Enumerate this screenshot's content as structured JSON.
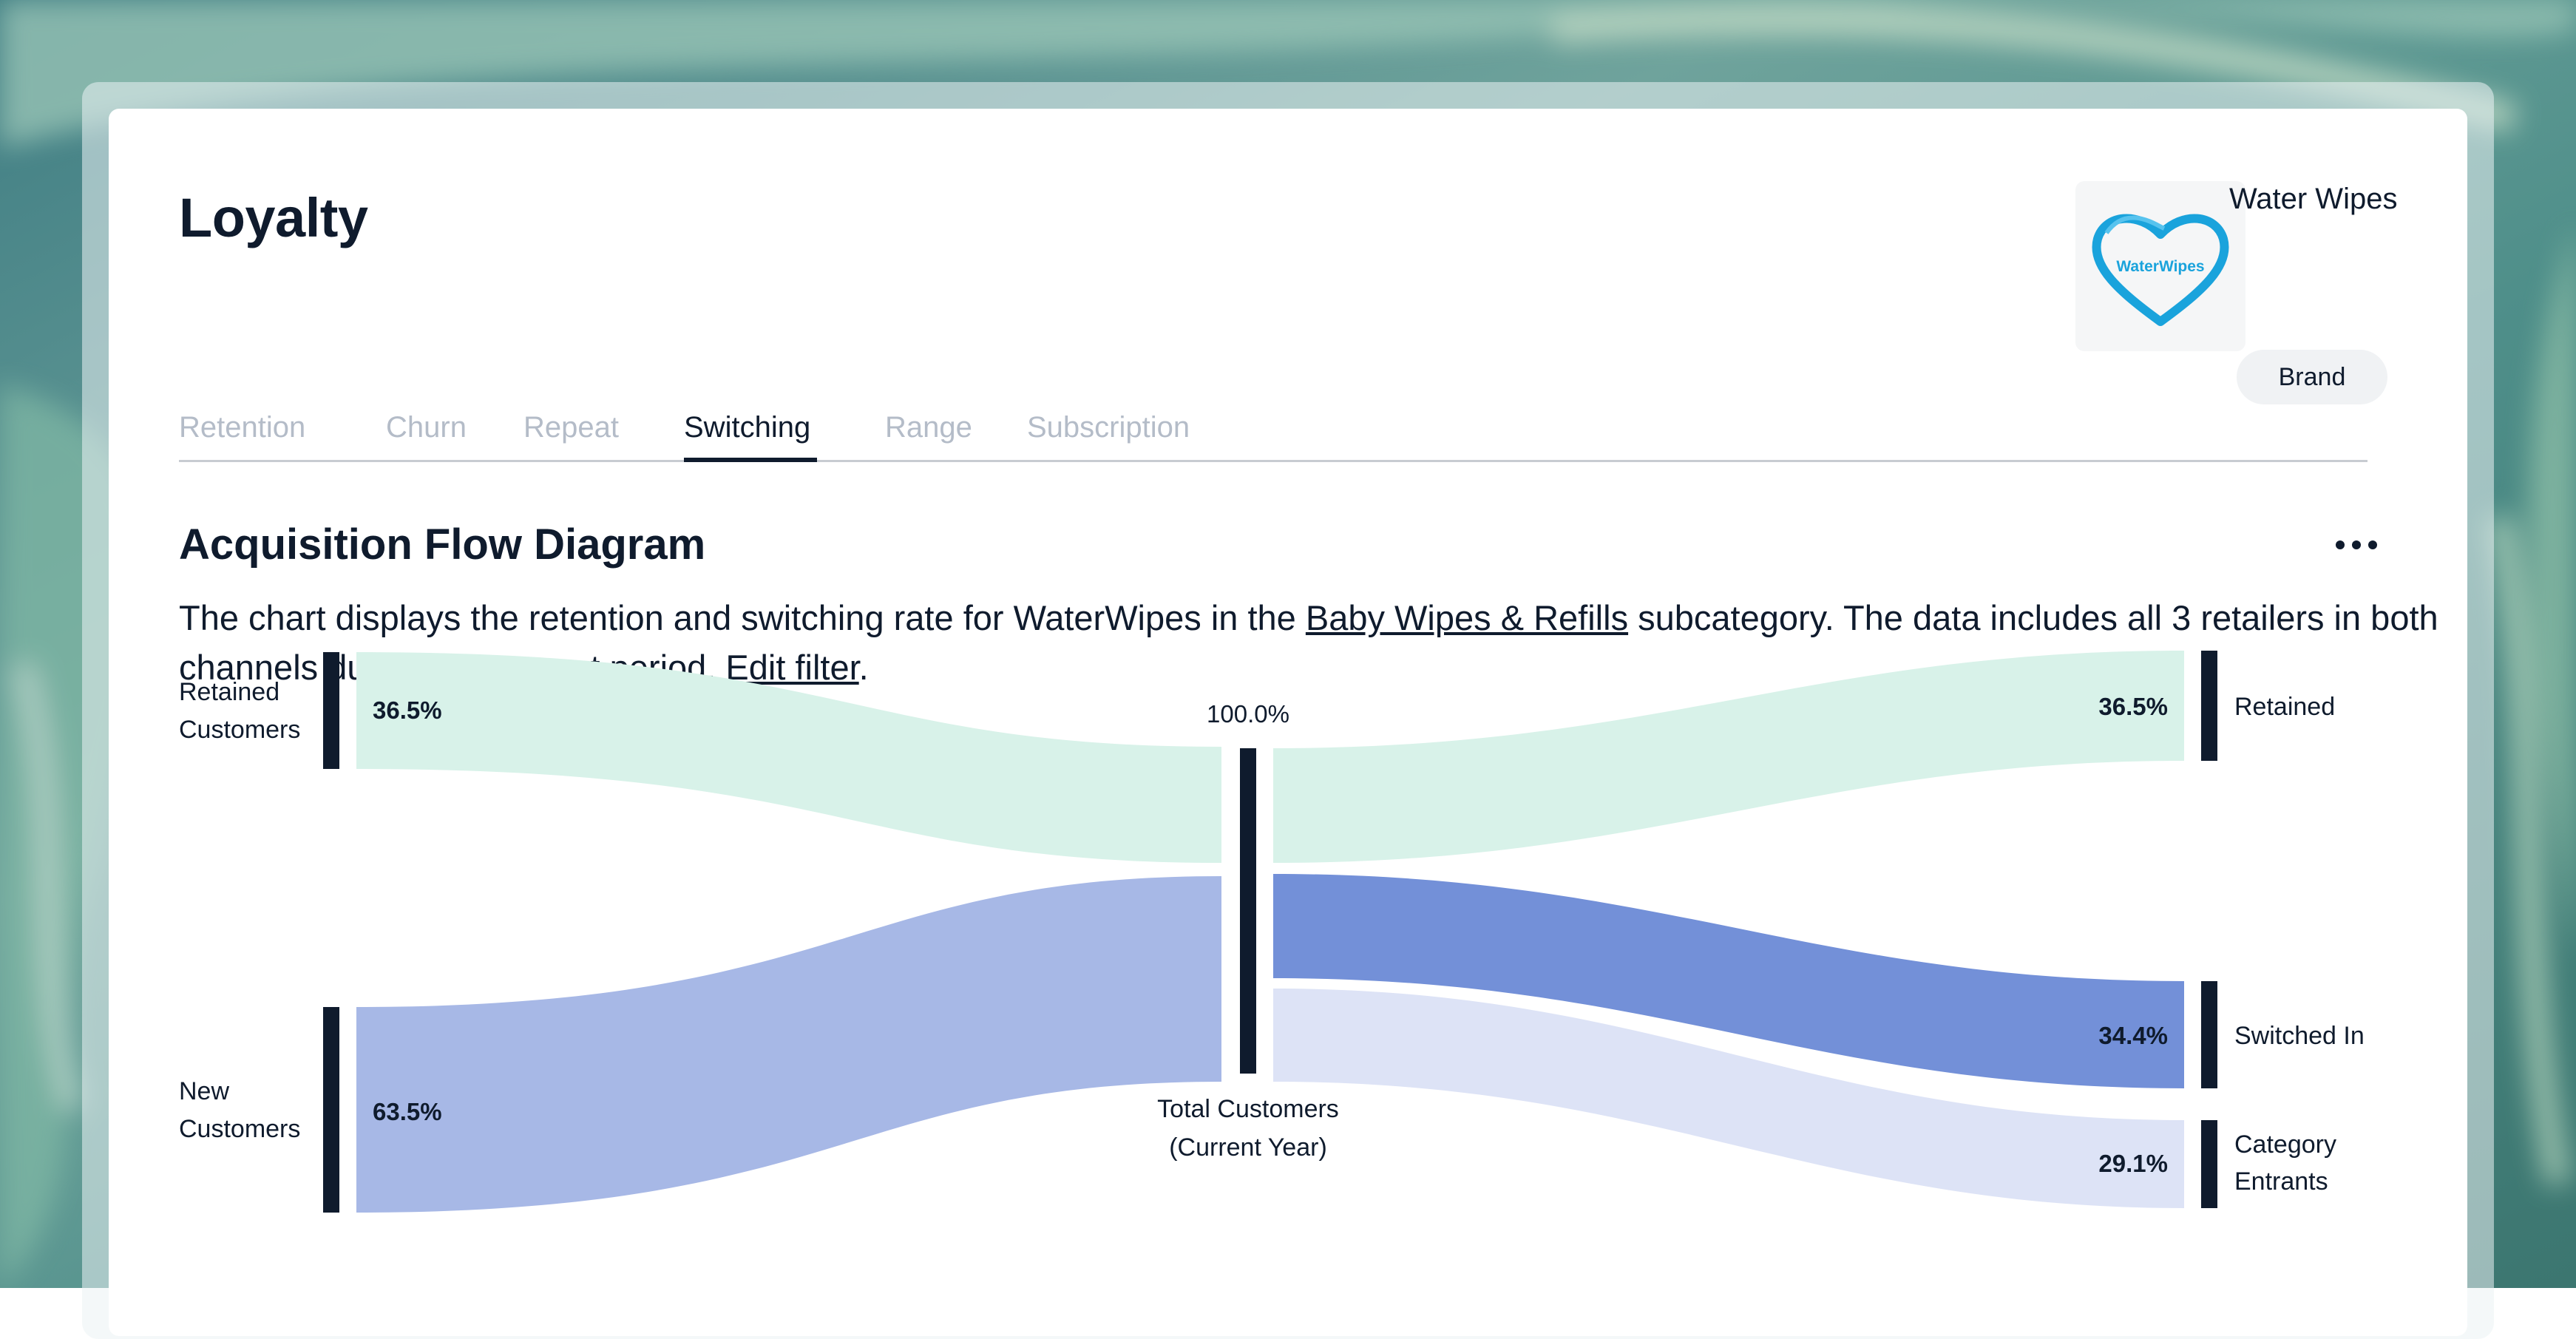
{
  "page": {
    "title": "Loyalty"
  },
  "tabs": [
    {
      "label": "Retention",
      "active": false
    },
    {
      "label": "Churn",
      "active": false
    },
    {
      "label": "Repeat",
      "active": false
    },
    {
      "label": "Switching",
      "active": true
    },
    {
      "label": "Range",
      "active": false
    },
    {
      "label": "Subscription",
      "active": false
    }
  ],
  "brand": {
    "name": "Water Wipes",
    "type_label": "Brand",
    "logo_text": "WaterWipes",
    "logo_color": "#1aa3dc"
  },
  "section": {
    "title": "Acquisition Flow Diagram",
    "more_icon": "ellipsis-icon",
    "description": {
      "part1": "The chart displays the retention and switching rate for WaterWipes in the ",
      "link1": "Baby Wipes & Refills",
      "part2": " subcategory. The data includes all 3 retailers in both channels during the current period. ",
      "link2": "Edit filter",
      "part3": "."
    }
  },
  "chart_data": {
    "type": "sankey",
    "center_node": {
      "label_line1": "Total Customers",
      "label_line2": "(Current Year)",
      "value": "100.0%"
    },
    "inflows": [
      {
        "label_line1": "Retained",
        "label_line2": "Customers",
        "value": 36.5,
        "display": "36.5%",
        "color": "#d8f2e9"
      },
      {
        "label_line1": "New",
        "label_line2": "Customers",
        "value": 63.5,
        "display": "63.5%",
        "color": "#a7b8e6"
      }
    ],
    "outflows": [
      {
        "label_line1": "Retained",
        "label_line2": "",
        "value": 36.5,
        "display": "36.5%",
        "color": "#d8f2e9"
      },
      {
        "label_line1": "Switched In",
        "label_line2": "",
        "value": 34.4,
        "display": "34.4%",
        "color": "#7390d8"
      },
      {
        "label_line1": "Category",
        "label_line2": "Entrants",
        "value": 29.1,
        "display": "29.1%",
        "color": "#dde3f6"
      }
    ],
    "node_color": "#0f1b2d"
  }
}
